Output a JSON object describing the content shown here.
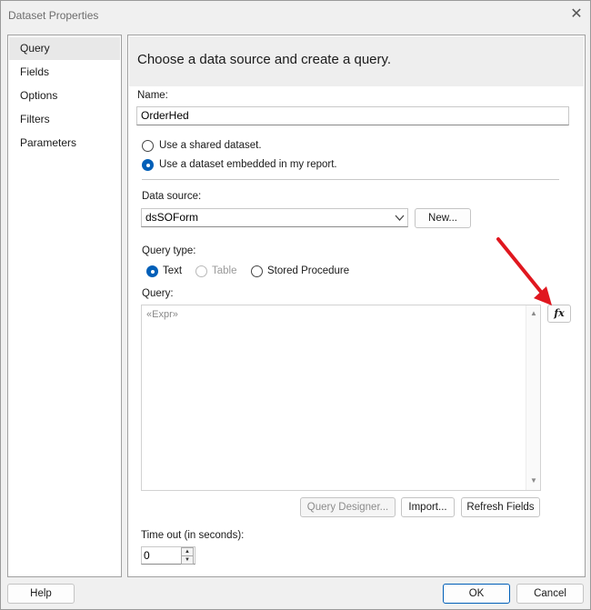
{
  "window": {
    "title": "Dataset Properties",
    "close_label": "✕"
  },
  "sidebar": {
    "items": [
      {
        "label": "Query",
        "selected": true
      },
      {
        "label": "Fields"
      },
      {
        "label": "Options"
      },
      {
        "label": "Filters"
      },
      {
        "label": "Parameters"
      }
    ]
  },
  "main": {
    "heading": "Choose a data source and create a query.",
    "name_label": "Name:",
    "name_value": "OrderHed",
    "radio_shared": "Use a shared dataset.",
    "radio_embedded": "Use a dataset embedded in my report.",
    "data_source_label": "Data source:",
    "data_source_value": "dsSOForm",
    "new_button": "New...",
    "query_type_label": "Query type:",
    "query_type_options": {
      "text": "Text",
      "table": "Table",
      "stored_procedure": "Stored Procedure"
    },
    "query_label": "Query:",
    "query_value": "«Expr»",
    "fx_label": "fx",
    "query_designer_button": "Query Designer...",
    "import_button": "Import...",
    "refresh_fields_button": "Refresh Fields",
    "timeout_label": "Time out (in seconds):",
    "timeout_value": "0"
  },
  "footer": {
    "help": "Help",
    "ok": "OK",
    "cancel": "Cancel"
  },
  "colors": {
    "accent": "#005fb8",
    "annotation_arrow": "#e0171f"
  }
}
